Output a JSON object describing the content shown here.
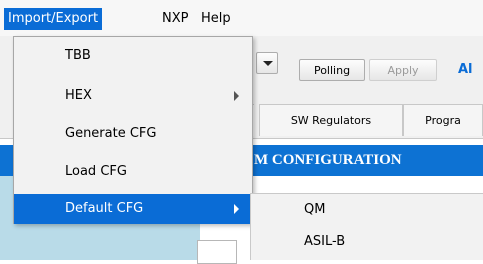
{
  "menubar": {
    "items": [
      "Import/Export",
      "NXP",
      "Help"
    ]
  },
  "toolbar": {
    "polling_label": "Polling",
    "apply_label": "Apply",
    "partial_label": "Al"
  },
  "tabs": [
    "SW Regulators",
    "Progra"
  ],
  "section": {
    "title": "M CONFIGURATION"
  },
  "import_export_menu": {
    "items": [
      {
        "label": "TBB",
        "has_submenu": false
      },
      {
        "label": "HEX",
        "has_submenu": true
      },
      {
        "label": "Generate CFG",
        "has_submenu": false
      },
      {
        "label": "Load CFG",
        "has_submenu": false
      },
      {
        "label": "Default CFG",
        "has_submenu": true,
        "selected": true
      }
    ]
  },
  "default_cfg_submenu": {
    "items": [
      "QM",
      "ASIL-B"
    ]
  },
  "colors": {
    "accent": "#0a6cd6",
    "header": "#0d72d3",
    "panel": "#b9dbe8"
  }
}
